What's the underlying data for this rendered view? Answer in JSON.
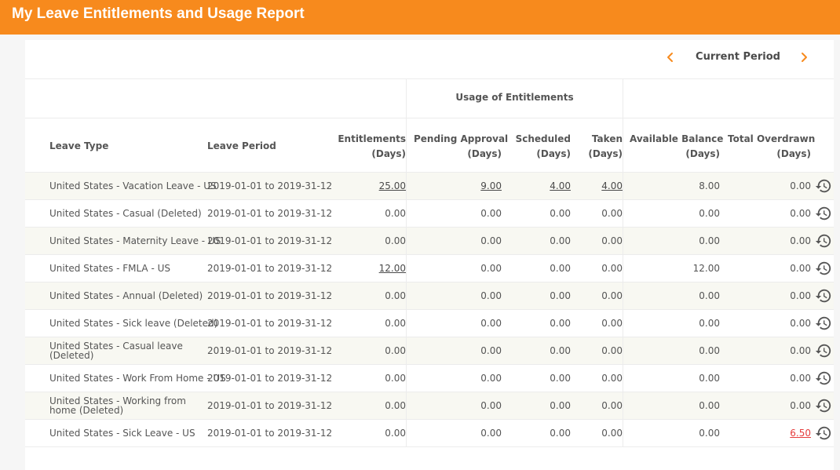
{
  "page": {
    "title": "My Leave Entitlements and Usage Report"
  },
  "period_nav": {
    "label": "Current Period"
  },
  "table": {
    "group_header": "Usage of Entitlements",
    "columns": {
      "leave_type": "Leave Type",
      "leave_period": "Leave Period",
      "entitlements_l1": "Entitlements",
      "entitlements_l2": "(Days)",
      "pending_l1": "Pending Approval",
      "pending_l2": "(Days)",
      "scheduled_l1": "Scheduled",
      "scheduled_l2": "(Days)",
      "taken_l1": "Taken",
      "taken_l2": "(Days)",
      "available_l1": "Available Balance",
      "available_l2": "(Days)",
      "overdrawn_l1": "Total Overdrawn",
      "overdrawn_l2": "(Days)"
    },
    "rows": [
      {
        "leave_type": "United States - Vacation Leave - US",
        "leave_period": "2019-01-01 to 2019-31-12",
        "entitlements": "25.00",
        "pending": "9.00",
        "scheduled": "4.00",
        "taken": "4.00",
        "available": "8.00",
        "overdrawn": "0.00"
      },
      {
        "leave_type": "United States - Casual (Deleted)",
        "leave_period": "2019-01-01 to 2019-31-12",
        "entitlements": "0.00",
        "pending": "0.00",
        "scheduled": "0.00",
        "taken": "0.00",
        "available": "0.00",
        "overdrawn": "0.00"
      },
      {
        "leave_type": "United States - Maternity Leave - US",
        "leave_period": "2019-01-01 to 2019-31-12",
        "entitlements": "0.00",
        "pending": "0.00",
        "scheduled": "0.00",
        "taken": "0.00",
        "available": "0.00",
        "overdrawn": "0.00"
      },
      {
        "leave_type": "United States - FMLA - US",
        "leave_period": "2019-01-01 to 2019-31-12",
        "entitlements": "12.00",
        "pending": "0.00",
        "scheduled": "0.00",
        "taken": "0.00",
        "available": "12.00",
        "overdrawn": "0.00"
      },
      {
        "leave_type": "United States - Annual (Deleted)",
        "leave_period": "2019-01-01 to 2019-31-12",
        "entitlements": "0.00",
        "pending": "0.00",
        "scheduled": "0.00",
        "taken": "0.00",
        "available": "0.00",
        "overdrawn": "0.00"
      },
      {
        "leave_type": "United States - Sick leave (Deleted)",
        "leave_period": "2019-01-01 to 2019-31-12",
        "entitlements": "0.00",
        "pending": "0.00",
        "scheduled": "0.00",
        "taken": "0.00",
        "available": "0.00",
        "overdrawn": "0.00"
      },
      {
        "leave_type": "United States - Casual leave (Deleted)",
        "leave_period": "2019-01-01 to 2019-31-12",
        "entitlements": "0.00",
        "pending": "0.00",
        "scheduled": "0.00",
        "taken": "0.00",
        "available": "0.00",
        "overdrawn": "0.00"
      },
      {
        "leave_type": "United States - Work From Home - US",
        "leave_period": "2019-01-01 to 2019-31-12",
        "entitlements": "0.00",
        "pending": "0.00",
        "scheduled": "0.00",
        "taken": "0.00",
        "available": "0.00",
        "overdrawn": "0.00"
      },
      {
        "leave_type": "United States - Working from home (Deleted)",
        "leave_period": "2019-01-01 to 2019-31-12",
        "entitlements": "0.00",
        "pending": "0.00",
        "scheduled": "0.00",
        "taken": "0.00",
        "available": "0.00",
        "overdrawn": "0.00"
      },
      {
        "leave_type": "United States - Sick Leave - US",
        "leave_period": "2019-01-01 to 2019-31-12",
        "entitlements": "0.00",
        "pending": "0.00",
        "scheduled": "0.00",
        "taken": "0.00",
        "available": "0.00",
        "overdrawn": "6.50"
      }
    ]
  },
  "colors": {
    "brand": "#f78a1d",
    "row_alt": "#f8f8f2",
    "overdrawn_link": "#e53b3b"
  },
  "icons": {
    "prev": "chevron-left-icon",
    "next": "chevron-right-icon",
    "history": "history-icon"
  }
}
